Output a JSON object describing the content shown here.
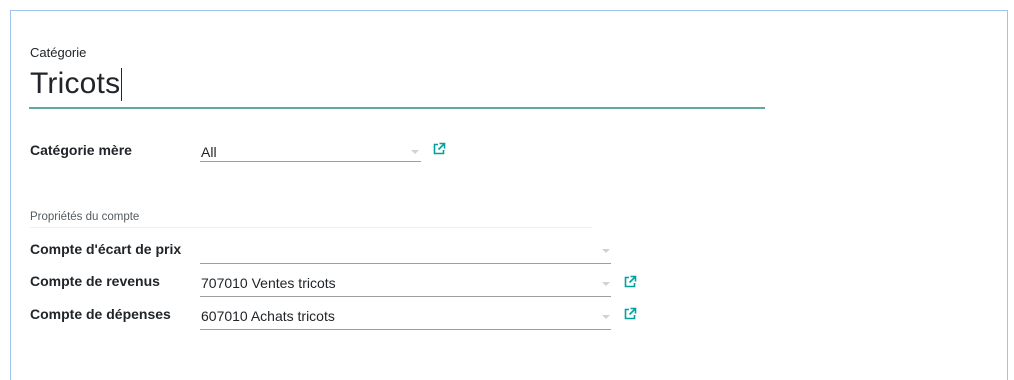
{
  "form": {
    "name_label": "Catégorie",
    "name_value": "Tricots",
    "parent": {
      "label": "Catégorie mère",
      "value": "All"
    },
    "account_section": {
      "title": "Propriétés du compte",
      "rows": [
        {
          "label": "Compte d'écart de prix",
          "value": ""
        },
        {
          "label": "Compte de revenus",
          "value": "707010 Ventes tricots"
        },
        {
          "label": "Compte de dépenses",
          "value": "607010 Achats tricots"
        }
      ]
    }
  },
  "icons": {
    "dropdown": "caret-down-icon",
    "external": "external-link-icon"
  },
  "colors": {
    "accent": "#00a09d",
    "title_underline": "#5fa8a4",
    "frame_border": "#9fc3ea",
    "field_line": "#9e9e9e"
  }
}
